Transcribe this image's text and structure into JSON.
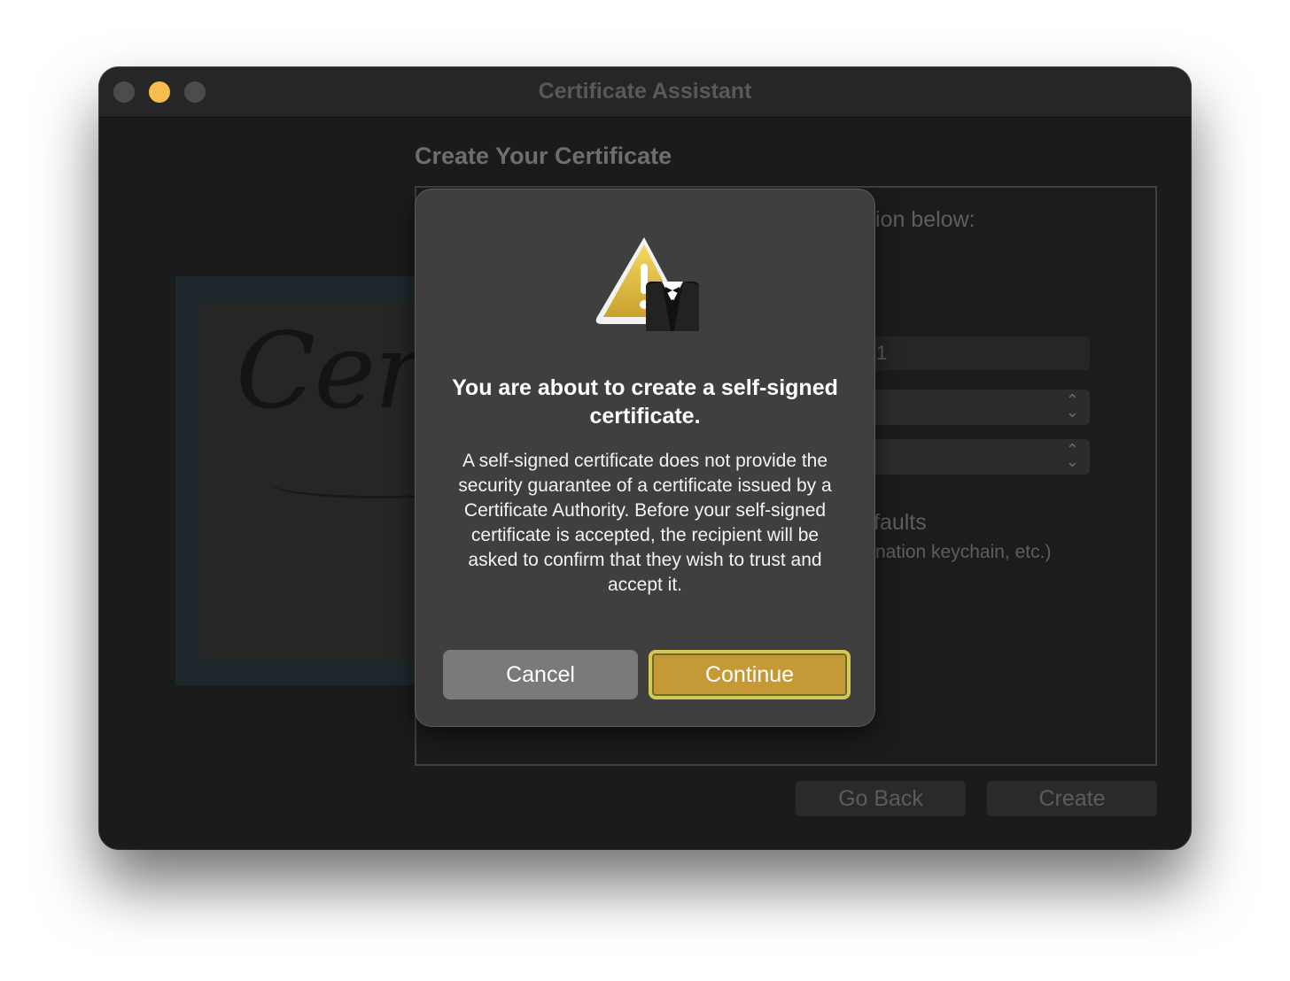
{
  "window": {
    "title": "Certificate Assistant",
    "heading": "Create Your Certificate",
    "background_fragments": {
      "instruction": "ion below:",
      "field_value": "1",
      "defaults_label": "faults",
      "defaults_hint": "nation keychain, etc.)"
    },
    "buttons": {
      "go_back": "Go Back",
      "create": "Create"
    }
  },
  "dialog": {
    "title": "You are about to create a self-signed certificate.",
    "body": "A self-signed certificate does not provide the security guarantee of a certificate issued by a Certificate Authority. Before your self-signed certificate is accepted, the recipient will be asked to confirm that they wish to trust and accept it.",
    "cancel_label": "Cancel",
    "continue_label": "Continue",
    "icon": "warning-triangle-tuxedo-icon"
  },
  "colors": {
    "accent": "#c59a36",
    "minimize": "#f7bd4c"
  }
}
